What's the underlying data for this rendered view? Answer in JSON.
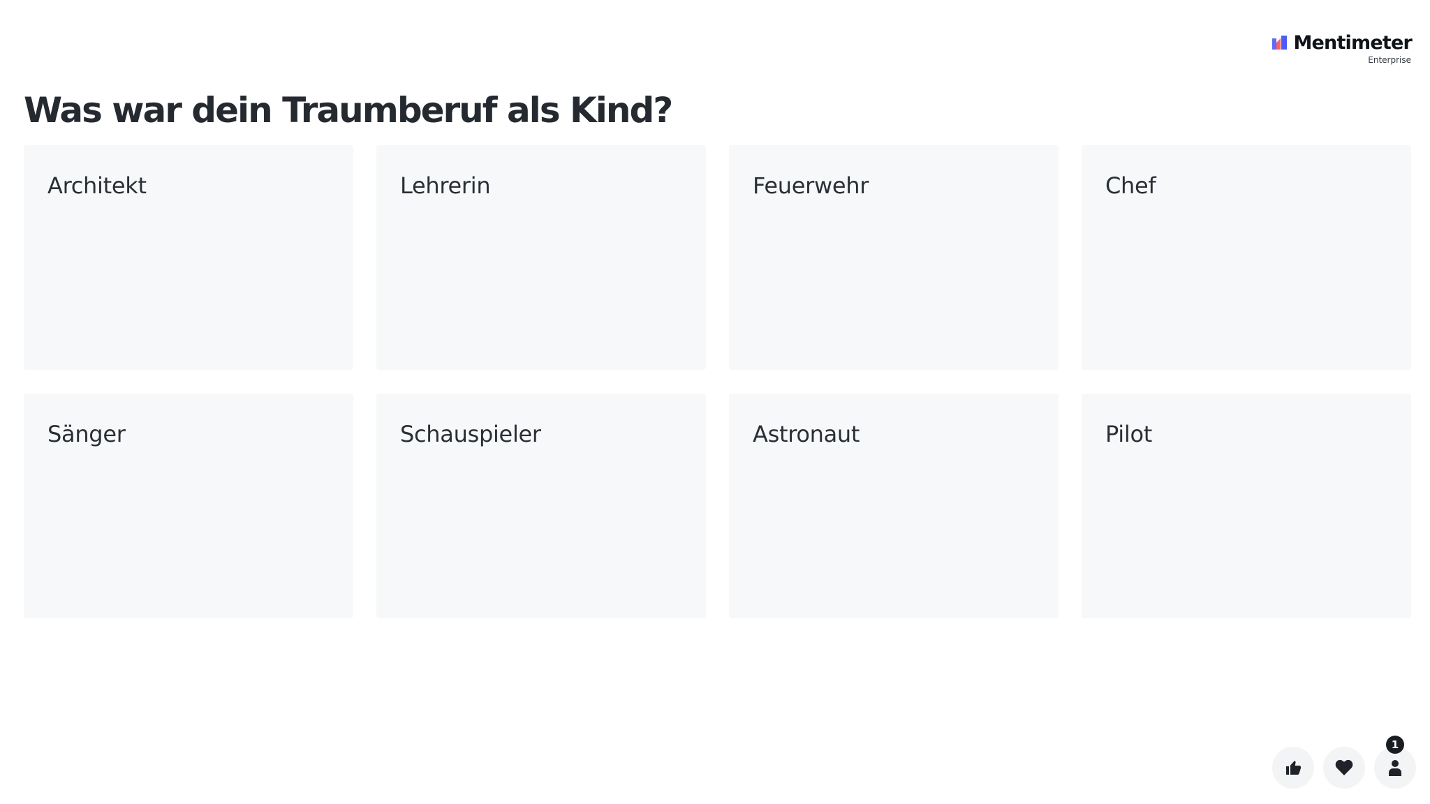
{
  "brand": {
    "name": "Mentimeter",
    "subtitle": "Enterprise",
    "logo_icon": "mentimeter-logo-icon",
    "logo_colors": [
      "#5b6cf9",
      "#ff5f6d",
      "#4a5cf5"
    ]
  },
  "question": {
    "title": "Was war dein Traumberuf als Kind?"
  },
  "answers": [
    {
      "text": "Architekt"
    },
    {
      "text": "Lehrerin"
    },
    {
      "text": "Feuerwehr"
    },
    {
      "text": "Chef"
    },
    {
      "text": "Sänger"
    },
    {
      "text": "Schauspieler"
    },
    {
      "text": "Astronaut"
    },
    {
      "text": "Pilot"
    }
  ],
  "reactions": {
    "thumbs_up_icon": "thumbs-up-icon",
    "heart_icon": "heart-icon",
    "audience_icon": "person-icon",
    "audience_count": "1"
  },
  "colors": {
    "card_background": "#f7f8f9",
    "title_text": "#252a31",
    "reaction_background": "#f3f4f5",
    "badge_background": "#1a1d21"
  }
}
